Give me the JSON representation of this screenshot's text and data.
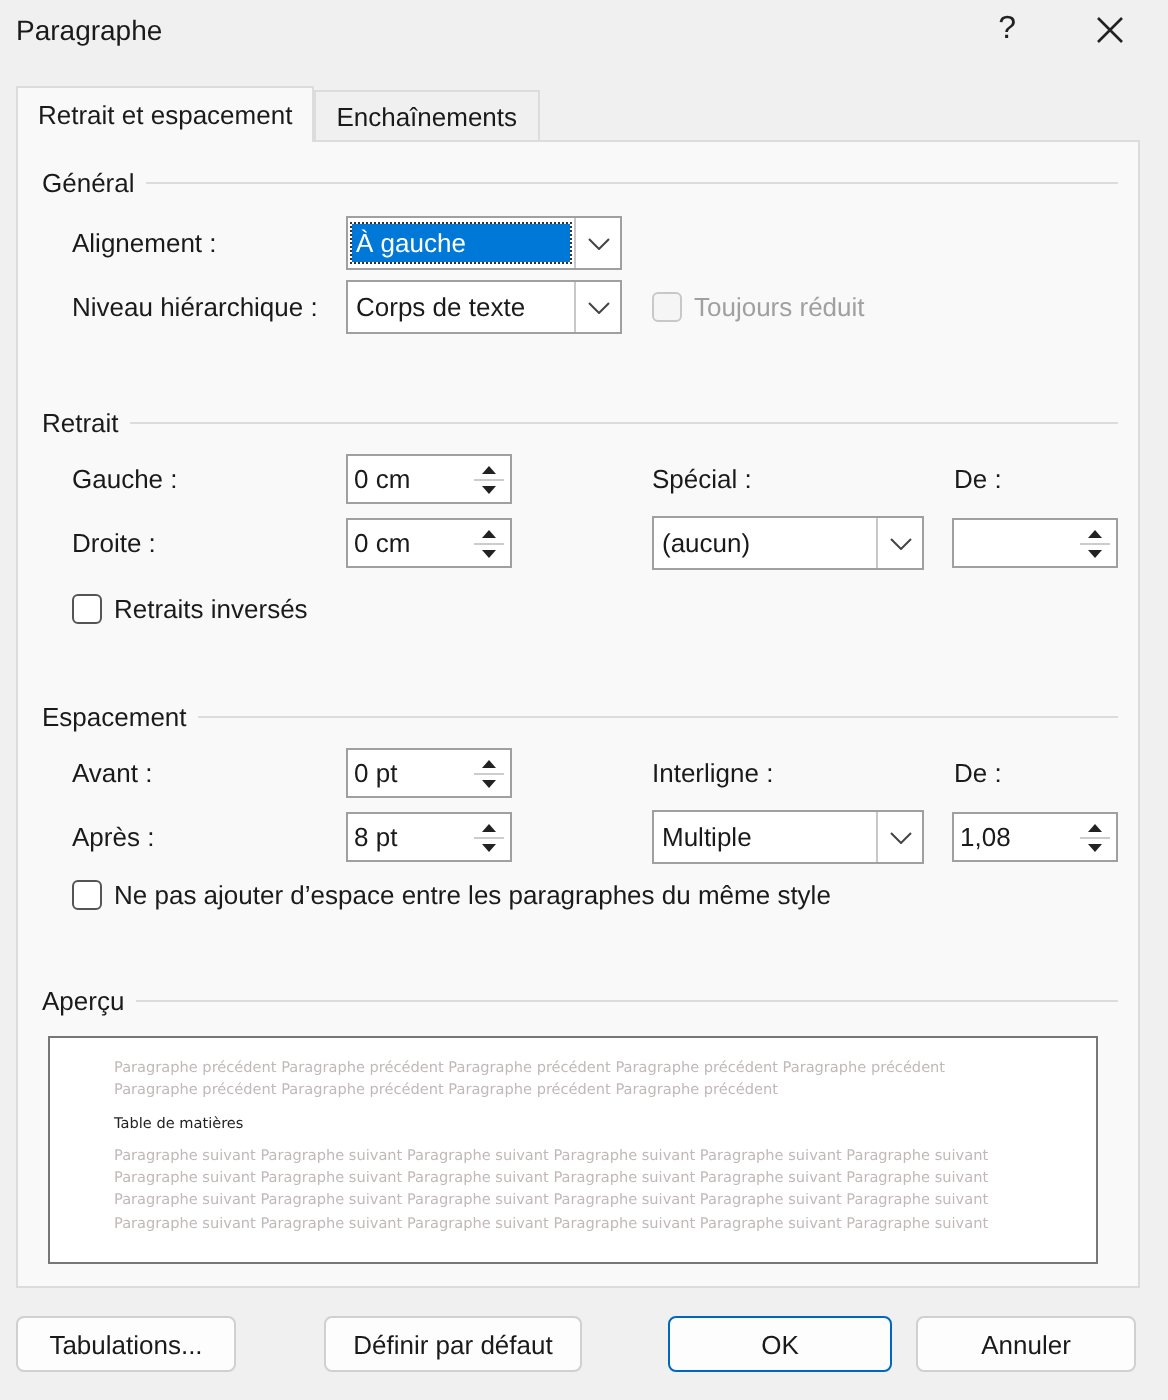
{
  "window": {
    "title": "Paragraphe",
    "help": "?"
  },
  "tabs": [
    {
      "label": "Retrait et espacement",
      "selected": true
    },
    {
      "label": "Enchaînements",
      "selected": false
    }
  ],
  "general": {
    "heading": "Général",
    "alignment": {
      "label": "Alignement :",
      "value": "À gauche",
      "focused": true
    },
    "outline_level": {
      "label": "Niveau hiérarchique :",
      "value": "Corps de texte",
      "focused": false
    },
    "collapsed": {
      "label": "Toujours réduit",
      "checked": false,
      "disabled": true
    }
  },
  "indentation": {
    "heading": "Retrait",
    "left": {
      "label": "Gauche :",
      "value": "0 cm"
    },
    "right": {
      "label": "Droite :",
      "value": "0 cm"
    },
    "special": {
      "label": "Spécial :",
      "value": "(aucun)",
      "focused": false
    },
    "by": {
      "label": "De :"
    },
    "mirror": {
      "label": "Retraits inversés",
      "checked": false,
      "disabled": false
    }
  },
  "spacing": {
    "heading": "Espacement",
    "before": {
      "label": "Avant :",
      "value": "0 pt"
    },
    "after": {
      "label": "Après :",
      "value": "8 pt"
    },
    "line_spacing": {
      "label": "Interligne :",
      "value": "Multiple",
      "focused": false
    },
    "at": {
      "label": "De :",
      "value": "1,08"
    },
    "no_space": {
      "label": "Ne pas ajouter d’espace entre les paragraphes du même style",
      "checked": false,
      "disabled": false
    }
  },
  "preview": {
    "heading": "Aperçu",
    "previous_lines": [
      "Paragraphe précédent Paragraphe précédent Paragraphe précédent Paragraphe précédent Paragraphe précédent",
      "Paragraphe précédent Paragraphe précédent Paragraphe précédent Paragraphe précédent"
    ],
    "current": "Table de matières",
    "next_lines": [
      "Paragraphe suivant Paragraphe suivant Paragraphe suivant Paragraphe suivant Paragraphe suivant Paragraphe suivant",
      "Paragraphe suivant Paragraphe suivant Paragraphe suivant Paragraphe suivant Paragraphe suivant Paragraphe suivant",
      "Paragraphe suivant Paragraphe suivant Paragraphe suivant Paragraphe suivant Paragraphe suivant Paragraphe suivant",
      "Paragraphe suivant Paragraphe suivant Paragraphe suivant Paragraphe suivant Paragraphe suivant Paragraphe suivant"
    ]
  },
  "buttons": [
    {
      "label": "Tabulations...",
      "kind": "normal"
    },
    {
      "label": "Définir par défaut",
      "kind": "normal"
    },
    {
      "label": "OK",
      "kind": "default"
    },
    {
      "label": "Annuler",
      "kind": "normal"
    }
  ]
}
